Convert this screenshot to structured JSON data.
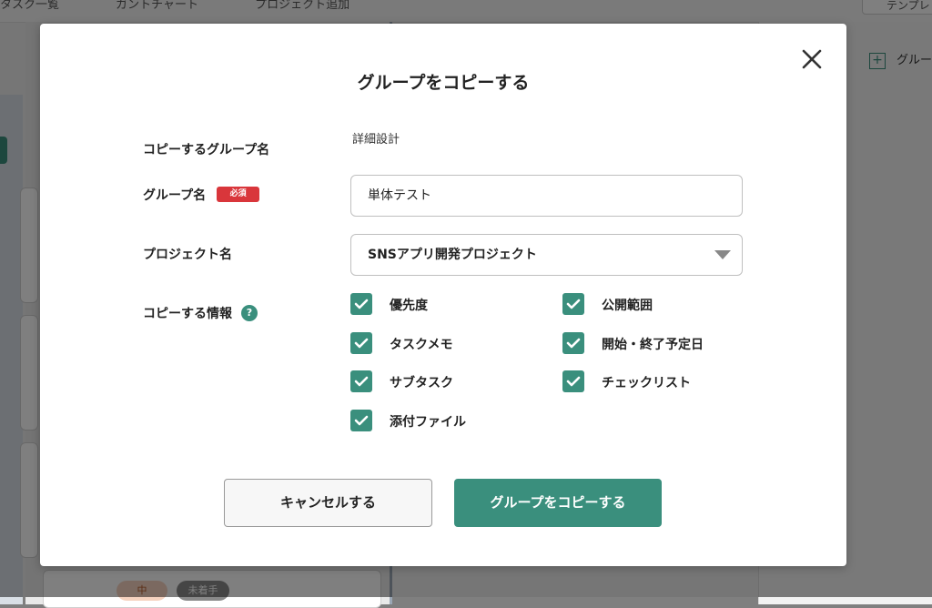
{
  "background": {
    "tabs": [
      "タスク一覧",
      "ガントチャート",
      "プロジェクト追加"
    ],
    "top_right_button": "テンプレ",
    "add_group_label": "グループを追加",
    "chips": {
      "priority": "中",
      "status": "未着手"
    }
  },
  "modal": {
    "title": "グループをコピーする",
    "source_group_label": "コピーするグループ名",
    "source_group_value": "詳細設計",
    "group_name_label": "グループ名",
    "required_badge": "必須",
    "group_name_value": "単体テスト",
    "project_label": "プロジェクト名",
    "project_value": "SNSアプリ開発プロジェクト",
    "copy_info_label": "コピーする情報",
    "help_glyph": "?",
    "options": [
      {
        "label": "優先度",
        "checked": true
      },
      {
        "label": "公開範囲",
        "checked": true
      },
      {
        "label": "タスクメモ",
        "checked": true
      },
      {
        "label": "開始・終了予定日",
        "checked": true
      },
      {
        "label": "サブタスク",
        "checked": true
      },
      {
        "label": "チェックリスト",
        "checked": true
      },
      {
        "label": "添付ファイル",
        "checked": true
      }
    ],
    "cancel_label": "キャンセルする",
    "submit_label": "グループをコピーする"
  },
  "colors": {
    "accent": "#3a8f7d",
    "required": "#d9363b",
    "overlay": "rgba(0,0,0,0.5)"
  },
  "icons": {
    "close": "close-icon",
    "check": "check-icon",
    "caret": "chevron-down-icon",
    "help": "help-icon"
  }
}
